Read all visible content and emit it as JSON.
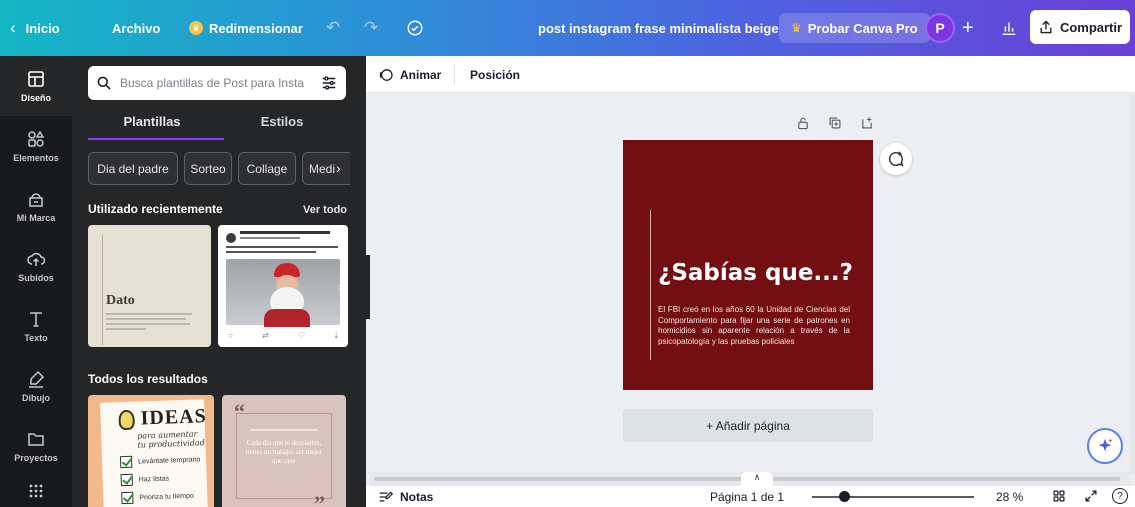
{
  "topbar": {
    "back_label": "Inicio",
    "file_label": "Archivo",
    "resize_label": "Redimensionar",
    "document_title": "post instagram frase minimalista beige",
    "pro_label": "Probar Canva Pro",
    "avatar_initial": "P",
    "share_label": "Compartir"
  },
  "rail": {
    "items": [
      {
        "label": "Diseño",
        "icon": "layout-icon",
        "active": true
      },
      {
        "label": "Elementos",
        "icon": "shapes-icon"
      },
      {
        "label": "Mi Marca",
        "icon": "brand-icon"
      },
      {
        "label": "Subidos",
        "icon": "cloud-upload-icon"
      },
      {
        "label": "Texto",
        "icon": "text-icon"
      },
      {
        "label": "Dibujo",
        "icon": "draw-icon"
      },
      {
        "label": "Proyectos",
        "icon": "folder-icon"
      },
      {
        "label": "",
        "icon": "apps-grid-icon"
      }
    ]
  },
  "panel": {
    "search_placeholder": "Busca plantillas de Post para Insta",
    "tabs": [
      "Plantillas",
      "Estilos"
    ],
    "chips": [
      "Dia del padre",
      "Sorteo",
      "Collage",
      "Medi"
    ],
    "recent_title": "Utilizado recientemente",
    "see_all": "Ver todo",
    "recent_thumb_title": "Dato",
    "all_results_title": "Todos los resultados",
    "ideas": {
      "title": "IDEAS",
      "subtitle": "para aumentar tu productividad",
      "items": [
        "Levántate temprano",
        "Haz listas",
        "Prioriza tu tiempo"
      ]
    },
    "quote_text": "Cada día que te despiertes, tienes un trabajo: ser mejor que ayer"
  },
  "editor": {
    "animate_label": "Animar",
    "position_label": "Posición",
    "post": {
      "headline": "¿Sabías que...?",
      "body": "El FBI creó en los años 60 la Unidad de Ciencias del Comportamiento para fijar una serie de patrones en homicidios sin aparente relación a través de la psicopatología y las pruebas policiales"
    },
    "add_page_label": "+ Añadir página"
  },
  "status": {
    "notes_label": "Notas",
    "page_indicator": "Página 1 de 1",
    "zoom": "28 %",
    "zoom_slider_fraction": 0.2,
    "help": "?"
  },
  "colors": {
    "post_bg": "#730f12",
    "accent": "#8b3dff",
    "panel_bg": "#252627",
    "rail_bg": "#18191b"
  }
}
